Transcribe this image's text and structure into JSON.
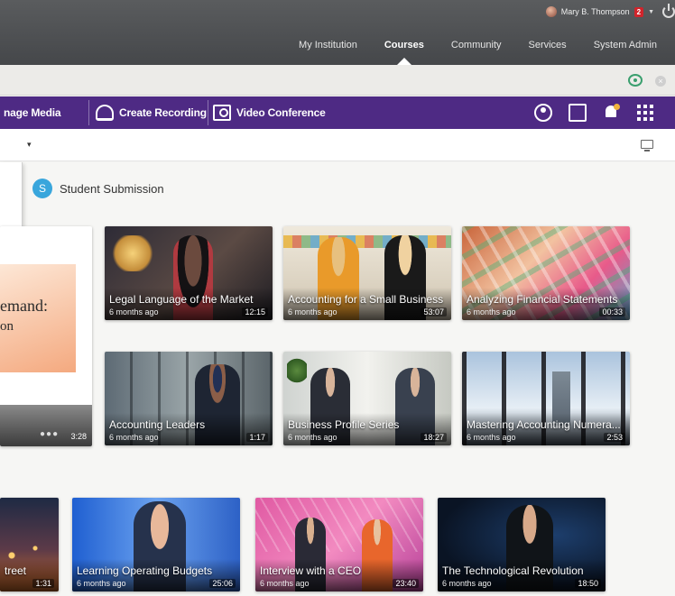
{
  "header": {
    "user_name": "Mary B. Thompson",
    "notification_count": "2",
    "nav": [
      {
        "label": "My Institution"
      },
      {
        "label": "Courses",
        "active": true
      },
      {
        "label": "Community"
      },
      {
        "label": "Services"
      },
      {
        "label": "System Admin"
      }
    ]
  },
  "toolbar": {
    "manage_media": "nage Media",
    "create_recording": "Create Recording",
    "video_conference": "Video Conference",
    "right_icons": [
      "account-icon",
      "external-link-icon",
      "notification-bell-icon",
      "apps-grid-icon"
    ],
    "bar_color": "#4e2a84"
  },
  "subbar": {
    "caret": "▾"
  },
  "section": {
    "avatar_letter": "S",
    "title": "Student Submission",
    "avatar_color": "#39a6dc"
  },
  "left_card": {
    "slide_title": "emand:",
    "slide_sub": "on",
    "duration": "3:28"
  },
  "videos_row1": [
    {
      "title": "Legal Language of the Market",
      "ago": "6 months ago",
      "duration": "12:15"
    },
    {
      "title": "Accounting for a Small Business",
      "ago": "6 months ago",
      "duration": "53:07"
    },
    {
      "title": "Analyzing Financial Statements",
      "ago": "6 months ago",
      "duration": "00:33"
    }
  ],
  "videos_row2": [
    {
      "title": "Accounting Leaders",
      "ago": "6 months ago",
      "duration": "1:17"
    },
    {
      "title": "Business Profile Series",
      "ago": "6 months ago",
      "duration": "18:27"
    },
    {
      "title": "Mastering Accounting Numera...",
      "ago": "6 months ago",
      "duration": "2:53"
    }
  ],
  "videos_row3": [
    {
      "title": "treet",
      "ago": "",
      "duration": "1:31"
    },
    {
      "title": "Learning Operating Budgets",
      "ago": "6 months ago",
      "duration": "25:06"
    },
    {
      "title": "Interview with a CEO",
      "ago": "6 months ago",
      "duration": "23:40"
    },
    {
      "title": "The Technological Revolution",
      "ago": "6 months ago",
      "duration": "18:50"
    }
  ]
}
